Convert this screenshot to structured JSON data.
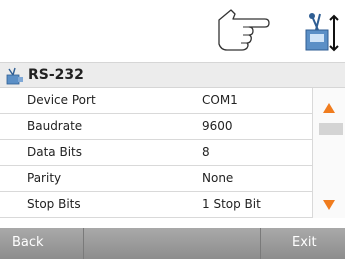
{
  "section": {
    "title": "RS-232"
  },
  "settings": [
    {
      "label": "Device Port",
      "value": "COM1"
    },
    {
      "label": "Baudrate",
      "value": "9600"
    },
    {
      "label": "Data Bits",
      "value": "8"
    },
    {
      "label": "Parity",
      "value": "None"
    },
    {
      "label": "Stop Bits",
      "value": "1 Stop Bit"
    }
  ],
  "footer": {
    "back_label": "Back",
    "exit_label": "Exit"
  },
  "icons": {
    "hand": "pointing-hand-icon",
    "device": "device-settings-icon",
    "section": "rs232-device-icon",
    "up": "arrow-up-icon",
    "down": "arrow-down-icon"
  },
  "colors": {
    "accent": "#f07c1e",
    "footer": "#999999",
    "header": "#ececec"
  }
}
